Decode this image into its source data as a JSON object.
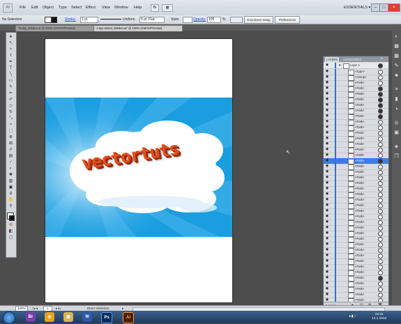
{
  "titlebar": {
    "app_logo": "Ai",
    "menu": [
      "File",
      "Edit",
      "Object",
      "Type",
      "Select",
      "Effect",
      "View",
      "Window",
      "Help"
    ],
    "mode_icon": "Br",
    "workspace": "ESSENTIALS ▾",
    "search_placeholder": ""
  },
  "controlbar": {
    "selection_label": "No Selection",
    "stroke_label": "Stroke:",
    "stroke_value": "1 pt",
    "uniform_label": "Uniform",
    "brush_value": "5 pt. Flat",
    "style_label": "Style:",
    "opacity_label": "Opacity:",
    "opacity_value": "100",
    "percent": "%",
    "doc_setup": "Document Setup",
    "preferences": "Preferences"
  },
  "tabs": [
    {
      "label": "Tooltip_Mitolen.ai @ 100% (CMYK/Preview)",
      "active": false
    },
    {
      "label": "1-tiyo Select_Mitolen.ai* @ 100% (CMYK/Preview)",
      "active": true
    }
  ],
  "artwork": {
    "text": "vectortuts",
    "sky_color": "#1a9ee0",
    "text_color": "#e2501d"
  },
  "layers_panel": {
    "tabs": [
      "LAYERS",
      "ARTBOARDS"
    ],
    "layer_name": "Layer 1",
    "rows": [
      {
        "name": "<Type>",
        "filled": false
      },
      {
        "name": "<Group>",
        "filled": false
      },
      {
        "name": "<Path>",
        "filled": false
      },
      {
        "name": "<Path>",
        "filled": true
      },
      {
        "name": "<Path>",
        "filled": true
      },
      {
        "name": "<Path>",
        "filled": true
      },
      {
        "name": "<Path>",
        "filled": true
      },
      {
        "name": "<Path>",
        "filled": true
      },
      {
        "name": "<Path>",
        "filled": true
      },
      {
        "name": "<Path>",
        "filled": false
      },
      {
        "name": "<Path>",
        "filled": false
      },
      {
        "name": "<Path>",
        "filled": false
      },
      {
        "name": "<Path>",
        "filled": false
      },
      {
        "name": "<Path>",
        "filled": false
      },
      {
        "name": "<Path>",
        "filled": false
      },
      {
        "name": "<Path>",
        "filled": false
      },
      {
        "name": "<Path>",
        "filled": true,
        "selected": true
      },
      {
        "name": "<Path>",
        "filled": false
      },
      {
        "name": "<Path>",
        "filled": false
      },
      {
        "name": "<Path>",
        "filled": false
      },
      {
        "name": "<Path>",
        "filled": false
      },
      {
        "name": "<Path>",
        "filled": false
      },
      {
        "name": "<Path>",
        "filled": false
      },
      {
        "name": "<Path>",
        "filled": false
      },
      {
        "name": "<Path>",
        "filled": false
      },
      {
        "name": "<Path>",
        "filled": false
      },
      {
        "name": "<Path>",
        "filled": false
      },
      {
        "name": "<Path>",
        "filled": false
      },
      {
        "name": "<Path>",
        "filled": false
      },
      {
        "name": "<Path>",
        "filled": false
      },
      {
        "name": "<Path>",
        "filled": false
      },
      {
        "name": "<Path>",
        "filled": false
      },
      {
        "name": "<Path>",
        "filled": false
      },
      {
        "name": "<Path>",
        "filled": false
      },
      {
        "name": "<Path>",
        "filled": false
      },
      {
        "name": "<Path>",
        "filled": false
      },
      {
        "name": "<Path>",
        "filled": false
      },
      {
        "name": "<Path>",
        "filled": true
      },
      {
        "name": "<Path>",
        "filled": false
      },
      {
        "name": "<Path>",
        "filled": false
      },
      {
        "name": "<Path>",
        "filled": false
      },
      {
        "name": "<Path>",
        "filled": false
      },
      {
        "name": "<Path>",
        "filled": false
      }
    ],
    "footer_label": "1 Layer"
  },
  "statusbar": {
    "zoom": "100%",
    "page": "1",
    "tool": "Direct Selection"
  },
  "taskbar": {
    "apps": [
      "Br",
      "Ps",
      "Ai"
    ],
    "time": "16:31",
    "date": "14.1.2010"
  }
}
